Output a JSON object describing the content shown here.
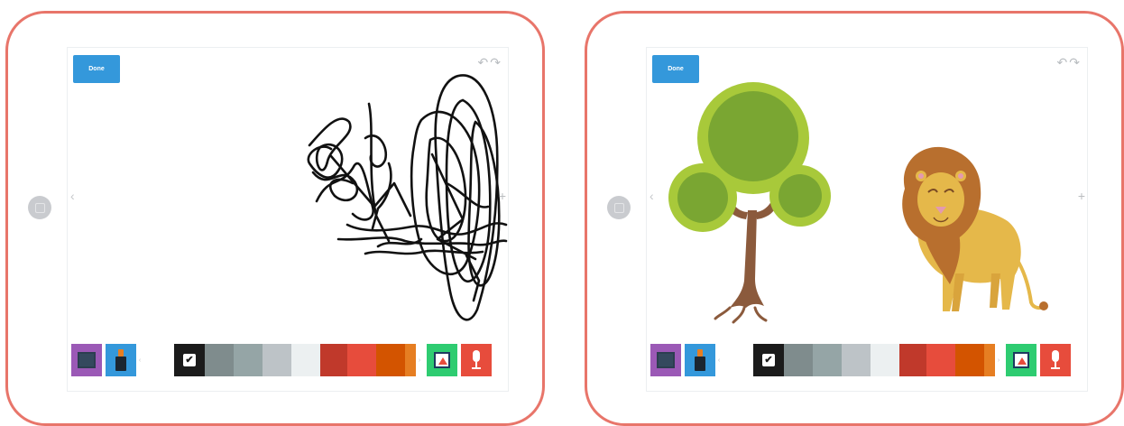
{
  "screens": [
    {
      "id": "scribble",
      "done_label": "Done",
      "undo_redo_glyph": "↶↷",
      "prev_glyph": "‹",
      "next_glyph": "+"
    },
    {
      "id": "tree-lion",
      "done_label": "Done",
      "undo_redo_glyph": "↶↷",
      "prev_glyph": "‹",
      "next_glyph": "+"
    }
  ],
  "toolbar": {
    "icons": [
      "background-icon",
      "marker-icon",
      "photo-icon",
      "microphone-icon"
    ],
    "selected_color": "#1b1b1b",
    "palette": [
      {
        "color": "#ffffff",
        "name": "white"
      },
      {
        "color": "#1b1b1b",
        "name": "black"
      },
      {
        "color": "#7f8c8d",
        "name": "dark-gray"
      },
      {
        "color": "#95a5a6",
        "name": "gray"
      },
      {
        "color": "#bdc3c7",
        "name": "light-gray"
      },
      {
        "color": "#ecf0f1",
        "name": "off-white"
      },
      {
        "color": "#c0392b",
        "name": "dark-red"
      },
      {
        "color": "#e74c3c",
        "name": "red"
      },
      {
        "color": "#d35400",
        "name": "dark-orange"
      },
      {
        "color": "#e67e22",
        "name": "orange"
      }
    ],
    "scroll_left_glyph": "‹",
    "scroll_right_glyph": "›"
  },
  "colors": {
    "frame": "#e8756a",
    "done_button": "#3498db",
    "background_tool": "#9b59b6",
    "marker_tool": "#3498db",
    "photo_tool": "#2ecc71",
    "mic_tool": "#e74c3c"
  }
}
